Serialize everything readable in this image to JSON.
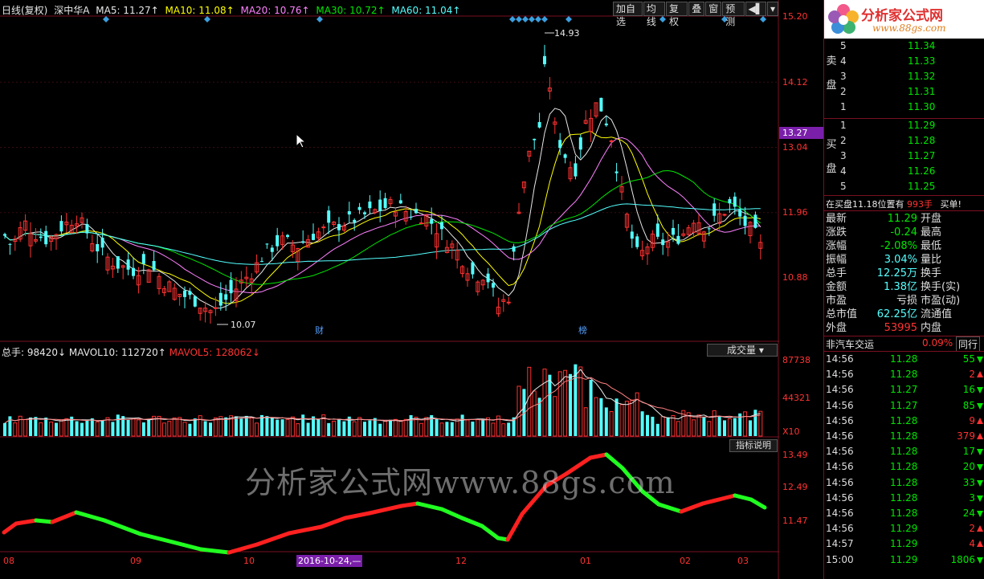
{
  "info_bar": {
    "period": "日线(复权)",
    "stock": "深中华A",
    "ma5": "MA5: 11.27↑",
    "ma10": "MA10: 11.08↑",
    "ma20": "MA20: 10.76↑",
    "ma30": "MA30: 10.72↑",
    "ma60": "MA60: 11.04↑"
  },
  "toolbar": [
    "加自选",
    "均线",
    "复权",
    "叠",
    "窗",
    "预测"
  ],
  "price_axis": [
    "15.20",
    "14.12",
    "13.04",
    "11.96",
    "10.88"
  ],
  "current_price_tag": "13.27",
  "high_label": "14.93",
  "low_label": "10.07",
  "markers": [
    "财",
    "榜"
  ],
  "volume": {
    "label": "总手: 98420↓",
    "mavol10": "MAVOL10: 112720↑",
    "mavol5": "MAVOL5: 128062↓",
    "button": "成交量",
    "axis": [
      "87738",
      "44321"
    ],
    "unit": "X10"
  },
  "indicator": {
    "button": "指标说明",
    "axis": [
      "13.49",
      "12.49",
      "11.47"
    ]
  },
  "x_ticks": [
    "08",
    "09",
    "10",
    "12",
    "01",
    "02",
    "03"
  ],
  "date_box": "2016-10-24,—",
  "watermark": "分析家公式网www.88gs.com",
  "logo": {
    "title": "分析家公式网",
    "url": "www.88gs.com"
  },
  "order_book": {
    "sell_label_1": "卖",
    "sell_label_2": "盘",
    "buy_label_1": "买",
    "buy_label_2": "盘",
    "asks": [
      {
        "level": "5",
        "price": "11.34"
      },
      {
        "level": "4",
        "price": "11.33"
      },
      {
        "level": "3",
        "price": "11.32"
      },
      {
        "level": "2",
        "price": "11.31"
      },
      {
        "level": "1",
        "price": "11.30"
      }
    ],
    "bids": [
      {
        "level": "1",
        "price": "11.29"
      },
      {
        "level": "2",
        "price": "11.28"
      },
      {
        "level": "3",
        "price": "11.27"
      },
      {
        "level": "4",
        "price": "11.26"
      },
      {
        "level": "5",
        "price": "11.25"
      }
    ],
    "note_prefix": "在买盘11.18位置有",
    "note_qty": "993手",
    "note_suffix": "买单!"
  },
  "stats": [
    {
      "k1": "最新",
      "v1": "11.29",
      "c1": "grn",
      "k2": "开盘"
    },
    {
      "k1": "涨跌",
      "v1": "-0.24",
      "c1": "grn",
      "k2": "最高"
    },
    {
      "k1": "涨幅",
      "v1": "-2.08%",
      "c1": "grn",
      "k2": "最低"
    },
    {
      "k1": "振幅",
      "v1": "3.04%",
      "c1": "cyn",
      "k2": "量比"
    },
    {
      "k1": "总手",
      "v1": "12.25万",
      "c1": "cyn",
      "k2": "换手"
    },
    {
      "k1": "金额",
      "v1": "1.38亿",
      "c1": "cyn",
      "k2": "换手(实)"
    },
    {
      "k1": "市盈",
      "v1": "亏损",
      "c1": "wht",
      "k2": "市盈(动)"
    },
    {
      "k1": "总市值",
      "v1": "62.25亿",
      "c1": "cyn",
      "k2": "流通值"
    },
    {
      "k1": "外盘",
      "v1": "53995",
      "c1": "red",
      "k2": "内盘"
    }
  ],
  "sector": {
    "name": "非汽车交运",
    "change": "0.09%",
    "tab": "同行"
  },
  "ticks": [
    {
      "time": "14:56",
      "price": "11.28",
      "vol": "55",
      "dir": "dn"
    },
    {
      "time": "14:56",
      "price": "11.28",
      "vol": "2",
      "dir": "up"
    },
    {
      "time": "14:56",
      "price": "11.27",
      "vol": "16",
      "dir": "dn"
    },
    {
      "time": "14:56",
      "price": "11.27",
      "vol": "85",
      "dir": "dn"
    },
    {
      "time": "14:56",
      "price": "11.28",
      "vol": "9",
      "dir": "up"
    },
    {
      "time": "14:56",
      "price": "11.28",
      "vol": "379",
      "dir": "up"
    },
    {
      "time": "14:56",
      "price": "11.28",
      "vol": "17",
      "dir": "dn"
    },
    {
      "time": "14:56",
      "price": "11.28",
      "vol": "20",
      "dir": "dn"
    },
    {
      "time": "14:56",
      "price": "11.28",
      "vol": "33",
      "dir": "dn"
    },
    {
      "time": "14:56",
      "price": "11.28",
      "vol": "3",
      "dir": "dn"
    },
    {
      "time": "14:56",
      "price": "11.28",
      "vol": "24",
      "dir": "dn"
    },
    {
      "time": "14:56",
      "price": "11.29",
      "vol": "2",
      "dir": "up"
    },
    {
      "time": "14:57",
      "price": "11.29",
      "vol": "4",
      "dir": "up"
    },
    {
      "time": "15:00",
      "price": "11.29",
      "vol": "1806",
      "dir": "dn"
    }
  ]
}
